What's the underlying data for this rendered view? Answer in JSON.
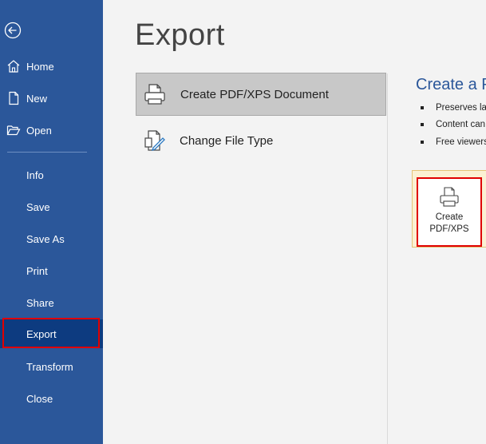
{
  "sidebar": {
    "items": [
      {
        "label": "Home",
        "icon": "home-icon"
      },
      {
        "label": "New",
        "icon": "new-document-icon"
      },
      {
        "label": "Open",
        "icon": "open-folder-icon"
      },
      {
        "label": "Info"
      },
      {
        "label": "Save"
      },
      {
        "label": "Save As"
      },
      {
        "label": "Print"
      },
      {
        "label": "Share"
      },
      {
        "label": "Export",
        "active": true
      },
      {
        "label": "Transform"
      },
      {
        "label": "Close"
      }
    ]
  },
  "main": {
    "title": "Export",
    "options": [
      {
        "label": "Create PDF/XPS Document",
        "icon": "pdf-document-icon",
        "selected": true
      },
      {
        "label": "Change File Type",
        "icon": "change-file-type-icon"
      }
    ]
  },
  "detail": {
    "title": "Create a P",
    "bullets": [
      "Preserves lay",
      "Content can",
      "Free viewers"
    ],
    "button_line1": "Create",
    "button_line2": "PDF/XPS"
  },
  "colors": {
    "sidebar_bg": "#2b579a",
    "active_bg": "#0d3b80",
    "highlight": "#e00000",
    "accent_text": "#2b579a"
  }
}
